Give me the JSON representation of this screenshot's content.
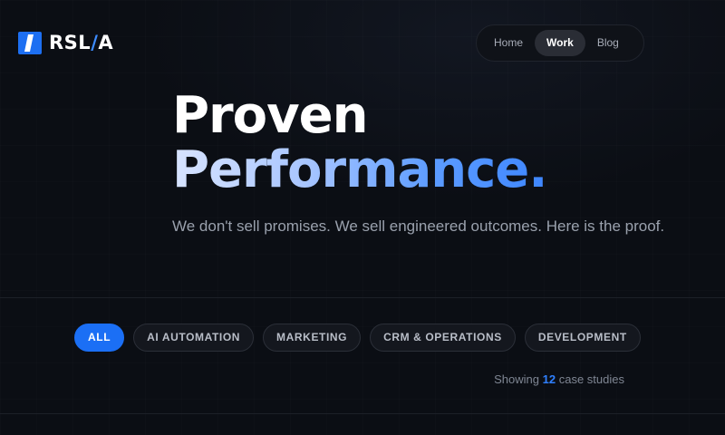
{
  "brand": {
    "logo_prefix": "RSL",
    "logo_slash": "/",
    "logo_suffix": "A",
    "accent_color": "#1d6ff2"
  },
  "nav": {
    "items": [
      {
        "label": "Home",
        "active": false
      },
      {
        "label": "Work",
        "active": true
      },
      {
        "label": "Blog",
        "active": false
      }
    ]
  },
  "hero": {
    "title_line1": "Proven",
    "title_line2": "Performance.",
    "subtitle": "We don't sell promises. We sell engineered outcomes. Here is the proof."
  },
  "filters": {
    "items": [
      {
        "label": "ALL",
        "active": true
      },
      {
        "label": "AI AUTOMATION",
        "active": false
      },
      {
        "label": "MARKETING",
        "active": false
      },
      {
        "label": "CRM & OPERATIONS",
        "active": false
      },
      {
        "label": "DEVELOPMENT",
        "active": false
      }
    ]
  },
  "results": {
    "prefix": "Showing",
    "count": "12",
    "suffix": "case studies"
  }
}
